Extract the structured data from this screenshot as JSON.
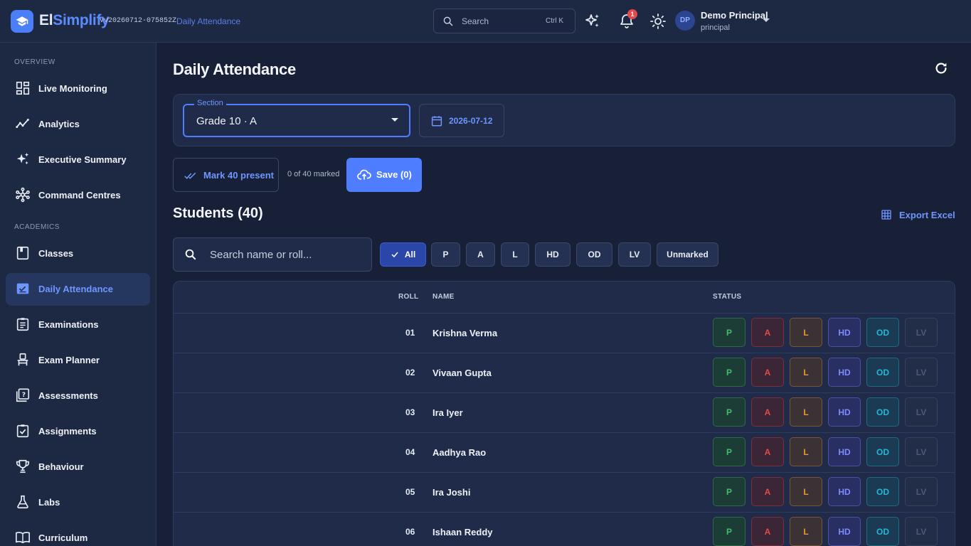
{
  "app": {
    "brand_prefix": "El",
    "brand_suffix": "Simplify",
    "version": "vv20260712-075852Z",
    "breadcrumb": "Daily Attendance"
  },
  "topbar": {
    "search_placeholder": "Search",
    "search_shortcut": "Ctrl K",
    "notification_count": "1",
    "user_initials": "DP",
    "user_name": "Demo Principal",
    "user_role": "principal"
  },
  "sidebar": {
    "sections": [
      {
        "title": "OVERVIEW"
      },
      {
        "title": "ACADEMICS"
      }
    ],
    "items": [
      {
        "label": "Live Monitoring",
        "icon": "dashboard-icon"
      },
      {
        "label": "Analytics",
        "icon": "trend-icon"
      },
      {
        "label": "Executive Summary",
        "icon": "sparkle-icon"
      },
      {
        "label": "Command Centres",
        "icon": "hub-icon"
      },
      {
        "label": "Classes",
        "icon": "book-icon"
      },
      {
        "label": "Daily Attendance",
        "icon": "attendance-icon",
        "active": true
      },
      {
        "label": "Examinations",
        "icon": "clipboard-icon"
      },
      {
        "label": "Exam Planner",
        "icon": "seat-icon"
      },
      {
        "label": "Assessments",
        "icon": "quiz-icon"
      },
      {
        "label": "Assignments",
        "icon": "task-icon"
      },
      {
        "label": "Behaviour",
        "icon": "trophy-icon"
      },
      {
        "label": "Labs",
        "icon": "flask-icon"
      },
      {
        "label": "Curriculum",
        "icon": "open-book-icon"
      }
    ]
  },
  "page": {
    "title": "Daily Attendance",
    "section_label": "Section",
    "section_value": "Grade 10 · A",
    "date_value": "2026-07-12",
    "mark_all_label": "Mark 40 present",
    "marked_count": "0 of 40 marked",
    "save_label": "Save (0)",
    "students_heading": "Students  (40)",
    "export_label": "Export Excel",
    "search_placeholder": "Search name or roll..."
  },
  "filters": [
    {
      "label": "All",
      "active": true
    },
    {
      "label": "P"
    },
    {
      "label": "A"
    },
    {
      "label": "L"
    },
    {
      "label": "HD"
    },
    {
      "label": "OD"
    },
    {
      "label": "LV"
    },
    {
      "label": "Unmarked"
    }
  ],
  "table": {
    "columns": {
      "roll": "ROLL",
      "name": "NAME",
      "status": "STATUS"
    },
    "status_options": [
      "P",
      "A",
      "L",
      "HD",
      "OD",
      "LV"
    ],
    "rows": [
      {
        "roll": "01",
        "name": "Krishna Verma"
      },
      {
        "roll": "02",
        "name": "Vivaan Gupta"
      },
      {
        "roll": "03",
        "name": "Ira Iyer"
      },
      {
        "roll": "04",
        "name": "Aadhya Rao"
      },
      {
        "roll": "05",
        "name": "Ira Joshi"
      },
      {
        "roll": "06",
        "name": "Ishaan Reddy"
      }
    ]
  },
  "colors": {
    "accent": "#4f7dff",
    "present": "#3fbf6a",
    "absent": "#e24b4b",
    "late": "#e79a2d",
    "half_day": "#7f8bff",
    "on_duty": "#27b5d6",
    "leave": "#4c5a78"
  }
}
